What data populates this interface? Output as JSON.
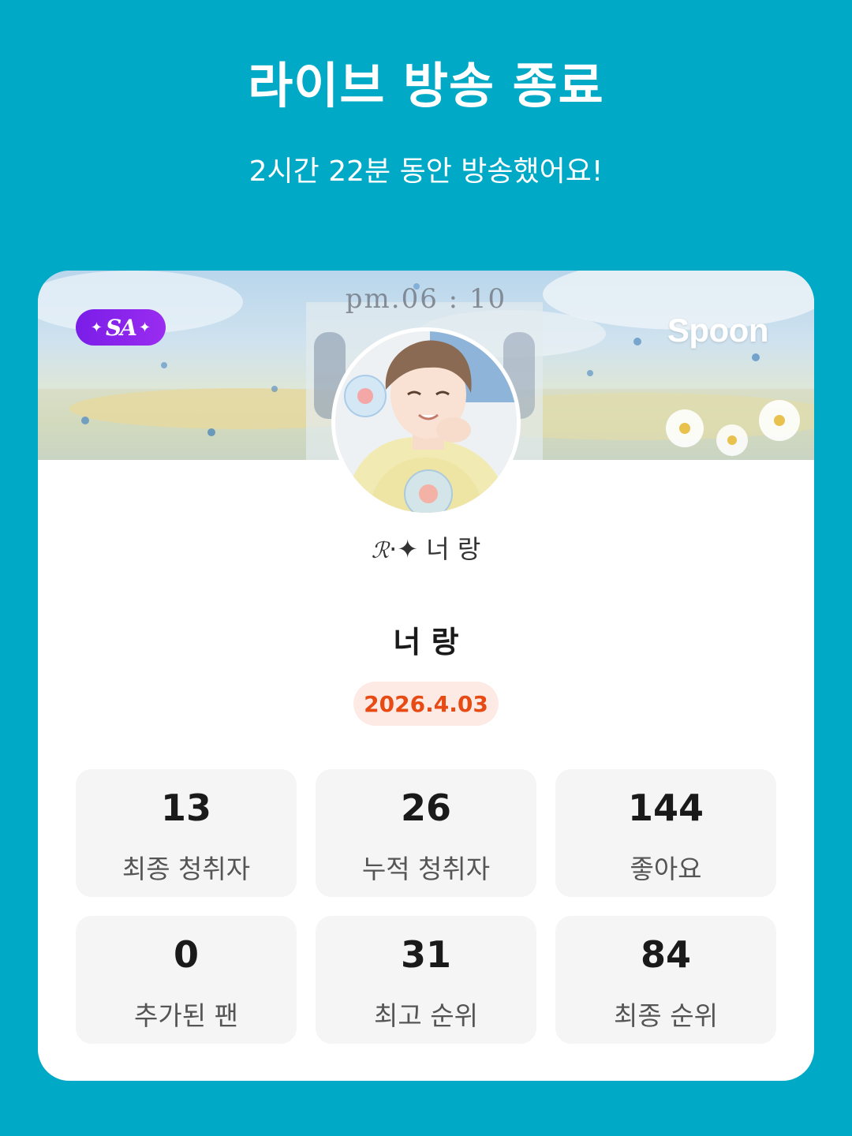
{
  "header": {
    "title": "라이브 방송 종료",
    "subtitle": "2시간 22분 동안 방송했어요!"
  },
  "banner": {
    "time_text": "pm.06 : 10",
    "badge_text": "SA",
    "logo_text": "Spoon"
  },
  "profile": {
    "tag_script": "ℛ",
    "tag_mark": "·✦",
    "tag_name": "너 랑",
    "name": "너 랑",
    "date": "2026.4.03"
  },
  "stats": [
    {
      "value": "13",
      "label": "최종 청취자"
    },
    {
      "value": "26",
      "label": "누적 청취자"
    },
    {
      "value": "144",
      "label": "좋아요"
    },
    {
      "value": "0",
      "label": "추가된 팬"
    },
    {
      "value": "31",
      "label": "최고 순위"
    },
    {
      "value": "84",
      "label": "최종 순위"
    }
  ],
  "colors": {
    "background": "#00aac6",
    "card": "#ffffff",
    "date_text": "#e84a14",
    "date_bg": "#fdeae4",
    "badge": "#8a22ee",
    "stat_bg": "#f5f5f6"
  },
  "icons": {
    "badge": "sa-sparkle-badge-icon",
    "logo": "spoon-logo"
  }
}
